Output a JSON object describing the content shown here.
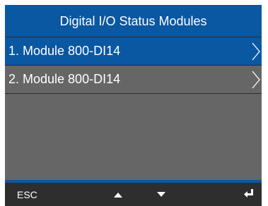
{
  "screen": {
    "title": "Digital I/O Status Modules"
  },
  "menu": {
    "items": [
      {
        "label": "1. Module 800-DI14",
        "selected": true
      },
      {
        "label": "2. Module 800-DI14",
        "selected": false
      }
    ]
  },
  "softkeys": {
    "esc_label": "ESC",
    "up_icon": "triangle-up-icon",
    "down_icon": "triangle-down-icon",
    "enter_icon": "enter-return-icon"
  },
  "colors": {
    "accent": "#0a57a2",
    "panel": "#666666",
    "softkey_bar": "#2e2e2e",
    "text": "#ffffff"
  }
}
